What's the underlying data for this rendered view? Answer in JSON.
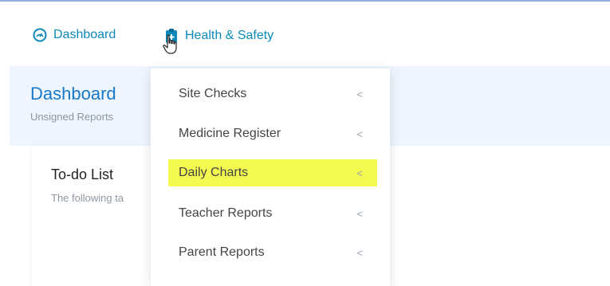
{
  "nav": {
    "dashboard": "Dashboard",
    "health_safety": "Health & Safety"
  },
  "page": {
    "title": "Dashboard",
    "subtitle": "Unsigned Reports"
  },
  "card": {
    "title": "To-do List",
    "text": "The following ta"
  },
  "menu": {
    "items": [
      {
        "label": "Site Checks"
      },
      {
        "label": "Medicine Register"
      },
      {
        "label": "Daily Charts"
      },
      {
        "label": "Teacher Reports"
      },
      {
        "label": "Parent Reports"
      }
    ],
    "chevron": "<"
  },
  "colors": {
    "accent": "#0c89b9",
    "title": "#1979c9",
    "highlight": "#f4fb50",
    "banner": "#eef5fe"
  }
}
